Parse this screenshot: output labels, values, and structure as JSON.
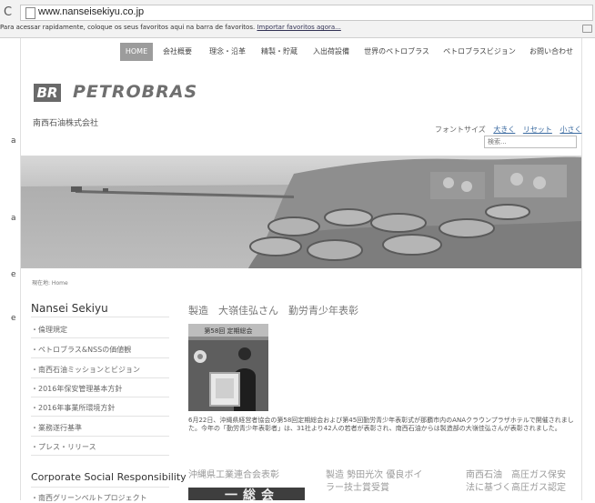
{
  "browser": {
    "reload_glyph": "C",
    "url": "www.nanseisekiyu.co.jp",
    "bookmarks_hint": "Para acessar rapidamente, coloque os seus favoritos aqui na barra de favoritos.",
    "bookmarks_link": "Importar favoritos agora..."
  },
  "margin_marks": [
    "a",
    "a",
    "e",
    "e"
  ],
  "nav": {
    "items": [
      "HOME",
      "会社概要",
      "理念・沿革",
      "精製・貯蔵",
      "入出荷設備",
      "世界のペトロブラス",
      "ペトロブラスビジョン",
      "お問い合わせ"
    ]
  },
  "header": {
    "logo_mark": "BR",
    "logo_word": "PETROBRAS",
    "company": "南西石油株式会社",
    "fontsize_label": "フォントサイズ",
    "fontsize_options": [
      "大きく",
      "リセット",
      "小さく"
    ],
    "search_placeholder": "検索..."
  },
  "breadcrumb": "現在地: Home",
  "sidebar": {
    "title": "Nansei Sekiyu",
    "items": [
      "・倫理規定",
      "・ペトロブラス&NSSの価値観",
      "・南西石油ミッションとビジョン",
      "・2016年保安管理基本方針",
      "・2016年事業所環境方針",
      "・業務遂行基準",
      "・プレス・リリース"
    ],
    "csr_title": "Corporate Social Responsibility",
    "csr_item": "・南西グリーンベルトプロジェクト"
  },
  "article": {
    "title": "製造　大嶺佳弘さん　勤労青少年表彰",
    "photo_banner": "第58回 定期総会",
    "body": "6月22日、沖縄県経営者協会の第58回定期総会および第45回勤労青少年表彰式が那覇市内のANAクラウンプラザホテルで開催されました。今年の「勤労青少年表彰者」は、31社より42人の若者が表彰され、南西石油からは製造部の大嶺佳弘さんが表彰されました。"
  },
  "subnews": [
    {
      "lines": [
        "沖縄県工業連合会表彰"
      ]
    },
    {
      "lines": [
        "製造 勢田光次 優良ボイ",
        "ラー技士賞受賞"
      ]
    },
    {
      "lines": [
        "南西石油　高圧ガス保安",
        "法に基づく高圧ガス認定"
      ]
    }
  ],
  "sub_photo_text": "一総会"
}
